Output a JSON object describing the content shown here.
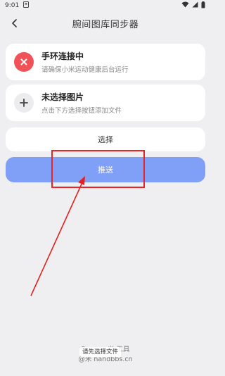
{
  "status_bar": {
    "time": "9:01"
  },
  "header": {
    "title": "腕间图库同步器"
  },
  "connection_card": {
    "title": "手环连接中",
    "subtitle": "请确保小米运动健康后台运行",
    "icon": "close-icon",
    "color": "#f05357"
  },
  "image_card": {
    "title": "未选择图片",
    "subtitle": "点击下方选择按钮添加文件",
    "icon": "plus-icon"
  },
  "buttons": {
    "select_label": "选择",
    "push_label": "推送",
    "push_color": "#7fa0f6"
  },
  "footer": {
    "line1": "Powere      义 工具",
    "line2": "@米      nandbbs.cn"
  },
  "toast": {
    "message": "请先选择文件"
  },
  "annotation_color": "#e22222"
}
